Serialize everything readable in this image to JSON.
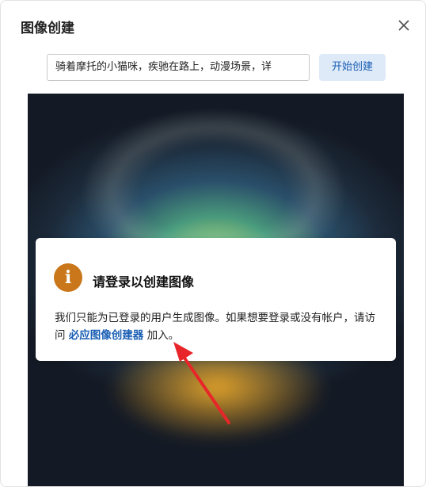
{
  "dialog": {
    "title": "图像创建",
    "close_icon": "close-icon"
  },
  "prompt": {
    "value": "骑着摩托的小猫咪，疾驰在路上，动漫场景，详"
  },
  "create_button": {
    "label": "开始创建",
    "bg_color": "#dfeaf9",
    "text_color": "#1a5fb4"
  },
  "notice": {
    "icon": "info-icon",
    "icon_color": "#c9771a",
    "icon_glyph": "i",
    "title": "请登录以创建图像",
    "body_prefix": "我们只能为已登录的用户生成图像。如果想要登录或没有帐户，请访问 ",
    "link_text": "必应图像创建器",
    "body_suffix": " 加入。"
  },
  "annotation": {
    "arrow_color": "#e8262a"
  }
}
